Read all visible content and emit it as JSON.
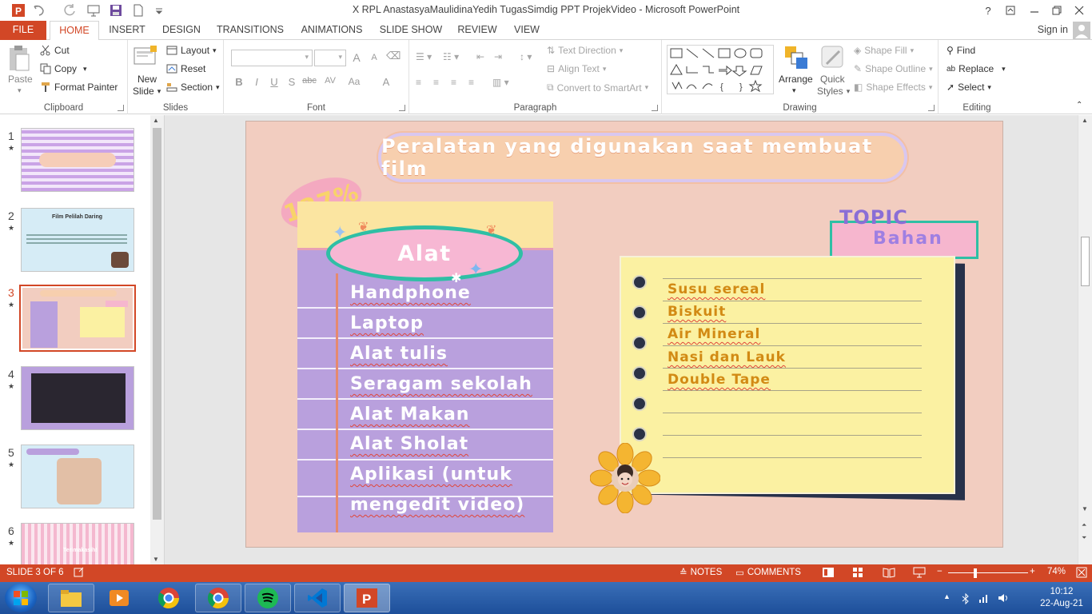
{
  "window": {
    "title": "X RPL AnastasyaMaulidinaYedih TugasSimdig PPT ProjekVideo - Microsoft PowerPoint",
    "help": "?",
    "signin": "Sign in"
  },
  "tabs": [
    "FILE",
    "HOME",
    "INSERT",
    "DESIGN",
    "TRANSITIONS",
    "ANIMATIONS",
    "SLIDE SHOW",
    "REVIEW",
    "VIEW"
  ],
  "ribbon": {
    "clipboard": {
      "paste": "Paste",
      "cut": "Cut",
      "copy": "Copy",
      "format_painter": "Format Painter",
      "label": "Clipboard"
    },
    "slides": {
      "new_slide_1": "New",
      "new_slide_2": "Slide",
      "layout": "Layout",
      "reset": "Reset",
      "section": "Section",
      "label": "Slides"
    },
    "font": {
      "label": "Font"
    },
    "paragraph": {
      "text_direction": "Text Direction",
      "align_text": "Align Text",
      "convert_smartart": "Convert to SmartArt",
      "label": "Paragraph"
    },
    "drawing": {
      "arrange": "Arrange",
      "quick_styles_1": "Quick",
      "quick_styles_2": "Styles",
      "shape_fill": "Shape Fill",
      "shape_outline": "Shape Outline",
      "shape_effects": "Shape Effects",
      "label": "Drawing"
    },
    "editing": {
      "find": "Find",
      "replace": "Replace",
      "select": "Select",
      "label": "Editing"
    }
  },
  "thumbnails": [
    {
      "num": "1",
      "star": "★",
      "caption": ""
    },
    {
      "num": "2",
      "star": "★",
      "caption": "Film Pelilah Daring"
    },
    {
      "num": "3",
      "star": "★",
      "caption": ""
    },
    {
      "num": "4",
      "star": "★",
      "caption": ""
    },
    {
      "num": "5",
      "star": "★",
      "caption": ""
    },
    {
      "num": "6",
      "star": "★",
      "caption": "Terimakasih!"
    }
  ],
  "slide": {
    "title": "Peralatan yang digunakan saat membuat film",
    "stamp": "127%",
    "alat_heading": "Alat",
    "alat_items": [
      "Handphone",
      "Laptop",
      "Alat tulis",
      "Seragam sekolah",
      "Alat Makan",
      "Alat Sholat",
      "Aplikasi (untuk",
      "mengedit video)"
    ],
    "topic": "TOPIC",
    "bahan_heading": "Bahan",
    "bahan_items": [
      "Susu sereal",
      "Biskuit",
      "Air Mineral",
      "Nasi dan Lauk",
      "Double Tape"
    ]
  },
  "status": {
    "slide_counter": "SLIDE 3 OF 6",
    "notes": "NOTES",
    "comments": "COMMENTS",
    "zoom": "74%"
  },
  "taskbar": {
    "time": "10:12",
    "date": "22-Aug-21"
  },
  "colors": {
    "accent": "#d24726",
    "slide_bg": "#f2cdc0",
    "notebook": "#b9a0dd",
    "paper": "#fbf1a2"
  }
}
